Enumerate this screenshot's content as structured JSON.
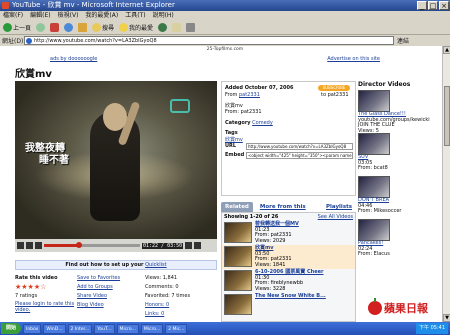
{
  "window": {
    "title": "YouTube - 欣賞 mv - Microsoft Internet Explorer",
    "controls": [
      "_",
      "□",
      "×"
    ]
  },
  "menubar": [
    "檔案(F)",
    "編輯(E)",
    "檢視(V)",
    "我的最愛(A)",
    "工具(T)",
    "說明(H)"
  ],
  "toolbar": {
    "back": "上一頁",
    "search": "搜尋",
    "favorites": "我的最愛"
  },
  "address": {
    "label": "網址(D)",
    "url": "http://www.youtube.com/watch?v=LA3ZbIGyoQ8",
    "go": "連結"
  },
  "page": {
    "topline": "25-Topfilms.com",
    "ads_left": "ads by doooooogle",
    "ads_right": "Advertise on this site",
    "video_title": "欣賞mv",
    "subtitle_line1": "我整夜轉",
    "subtitle_line2": "睡不著",
    "time": "01:22 / 03:50",
    "progress": 0.36,
    "findout": "Find out how to set up your",
    "findout_link": "Quicklist",
    "rating": {
      "rate_label": "Rate this video",
      "stars": "★★★★☆",
      "ratings": "7 ratings",
      "login": "Please login to rate this video.",
      "save": "Save to Favorites",
      "add": "Add to Groups",
      "share": "Share Video",
      "blog": "Blog Video",
      "views": "Views: 1,841",
      "comments": "Comments: 0",
      "favorited": "Favorited: 7 times",
      "honors": "Honors: 0",
      "links": "Links: 0"
    },
    "info": {
      "added": "Added  October 07, 2006",
      "from_label": "From",
      "from_user": "pat2331",
      "subscribe": "SUBSCRIBE",
      "to_user": "to pat2331",
      "desc": "欣賞mv",
      "from2": "From:  pat2331",
      "category_label": "Category",
      "category": "Comedy",
      "tags_label": "Tags",
      "tags": "欣賞mv",
      "url_label": "URL",
      "url": "http://www.youtube.com/watch?v=LA3ZbIGyoQ8",
      "embed_label": "Embed",
      "embed": "<object width=\"425\" height=\"350\"><param name"
    },
    "tabs": {
      "related": "Related",
      "more": "More from this user",
      "playlists": "Playlists"
    },
    "related_hdr": {
      "showing": "Showing 1-20 of 26",
      "see_all": "See All Videos"
    },
    "related": [
      {
        "title": "替我轉送我一個MV",
        "dur": "01:23",
        "from": "From: pat2331",
        "views": "Views: 2029",
        "now": false
      },
      {
        "title": "欣賞mv",
        "dur": "03:50",
        "from": "From: pat2331",
        "views": "Views: 1841",
        "now": true
      },
      {
        "title": "6-10-2006 國票萬寶 Cheer",
        "dur": "01:30",
        "from": "From: fireblynewbb",
        "views": "Views: 3228",
        "now": false
      },
      {
        "title": "The New Snow White B...",
        "dur": "",
        "from": "",
        "views": "",
        "now": false
      }
    ],
    "director": {
      "heading": "Director Videos",
      "items": [
        {
          "title": "The Glass Dance!!!",
          "line2": "youtube.com/groups/kewicki",
          "line3": "JOIN THE CLUE",
          "views": "Views: 5"
        },
        {
          "title": "SUV",
          "line2": "03:05",
          "line3": "From: bcat8",
          "views": ""
        },
        {
          "title": "DON'T BREA",
          "line2": "04:46",
          "line3": "From: Mikesoccer",
          "views": ""
        },
        {
          "title": "Pancakes!",
          "line2": "02:24",
          "line3": "From: Elacus",
          "views": ""
        }
      ]
    }
  },
  "taskbar": {
    "start": "開始",
    "tasks": [
      "Inbox",
      "WinD...",
      "2 Inter...",
      "YouT...",
      "Micro...",
      "Micro...",
      "2 Mic..."
    ],
    "clock": "下午 05:41"
  },
  "watermark": {
    "text": "蘋果日報"
  }
}
